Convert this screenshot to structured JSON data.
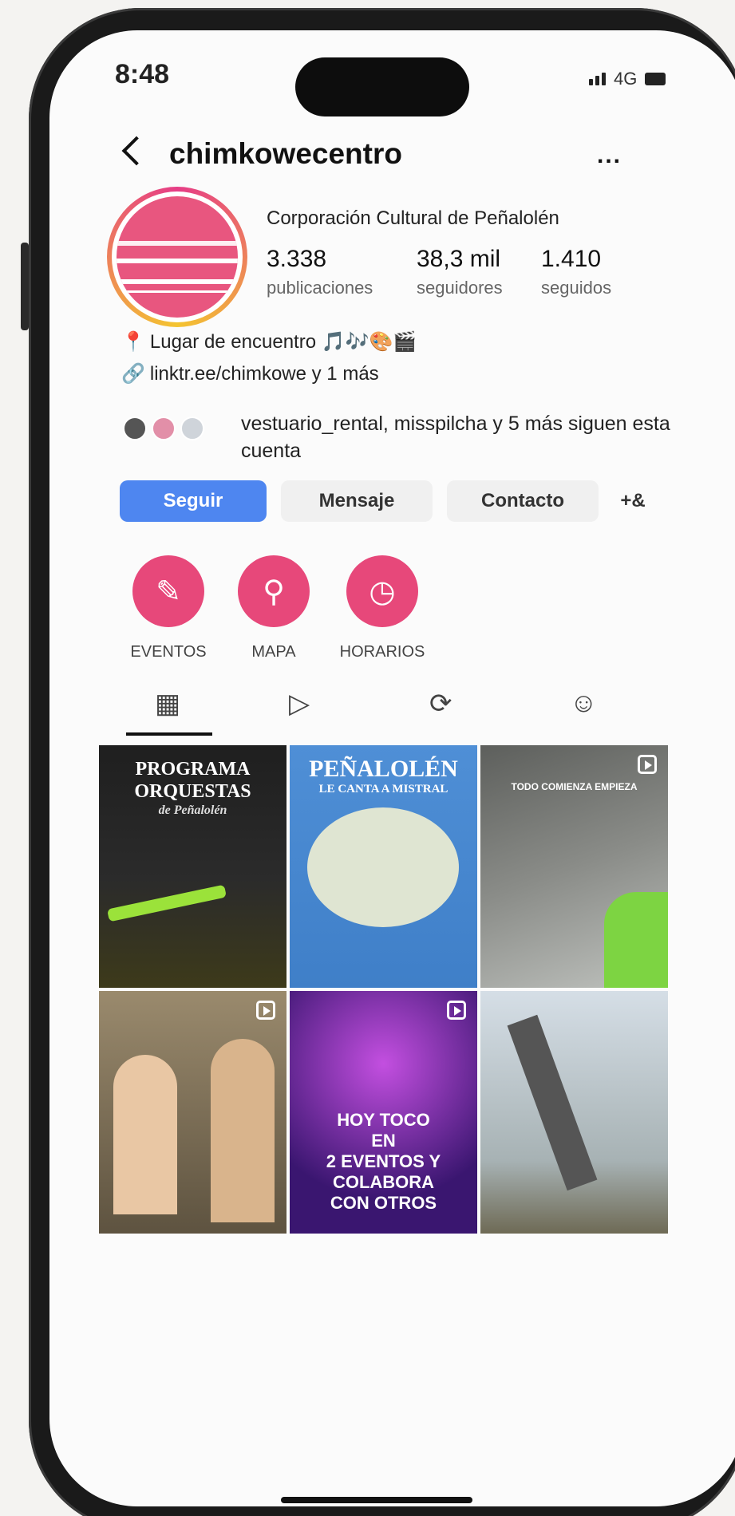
{
  "status_bar": {
    "time": "8:48",
    "network": "4G"
  },
  "header": {
    "username": "chimkowecentro",
    "back": "<",
    "more": "..."
  },
  "profile": {
    "name": "Corporación Cultural de Peñalolén",
    "stats": [
      {
        "number": "3.338",
        "label": "publicaciones"
      },
      {
        "number": "38,3 mil",
        "label": "seguidores"
      },
      {
        "number": "1.410",
        "label": "seguidos"
      }
    ],
    "bio_line1": "Lugar de encuentro 🎵🎶🎨🎬",
    "bio_link": "linktr.ee/chimkowe y 1 más",
    "followed_by": "vestuario_rental, misspilcha y 5 más siguen esta cuenta"
  },
  "actions": {
    "follow": "Seguir",
    "message": "Mensaje",
    "contact": "Contacto",
    "add_person": "+&"
  },
  "highlights": [
    {
      "label": "EVENTOS",
      "icon": "✎"
    },
    {
      "label": "MAPA",
      "icon": "⚲"
    },
    {
      "label": "HORARIOS",
      "icon": "◷"
    }
  ],
  "tabs": {
    "grid": "▦",
    "reels": "▷",
    "reposts": "⟳",
    "tagged": "☺"
  },
  "posts": [
    {
      "text1": "PROGRAMA",
      "text2": "ORQUESTAS",
      "text3": "de Peñalolén",
      "color": "#1f1f1f"
    },
    {
      "text1": "PEÑALOLÉN",
      "text2": "LE CANTA A MISTRAL",
      "color": "#4f8fd6"
    },
    {
      "text1": "TODO COMIENZA EMPIEZA",
      "color": "#6b6d6a"
    },
    {
      "color": "#7a6850"
    },
    {
      "text1": "HOY TOCO",
      "text2": "EN",
      "text3": "2 EVENTOS Y",
      "text4": "COLABORA",
      "text5": "CON OTROS",
      "color": "#3a1670"
    },
    {
      "color": "#b9c6cf"
    }
  ],
  "colors": {
    "accent": "#4e86f0",
    "highlight": "#e7487a"
  }
}
